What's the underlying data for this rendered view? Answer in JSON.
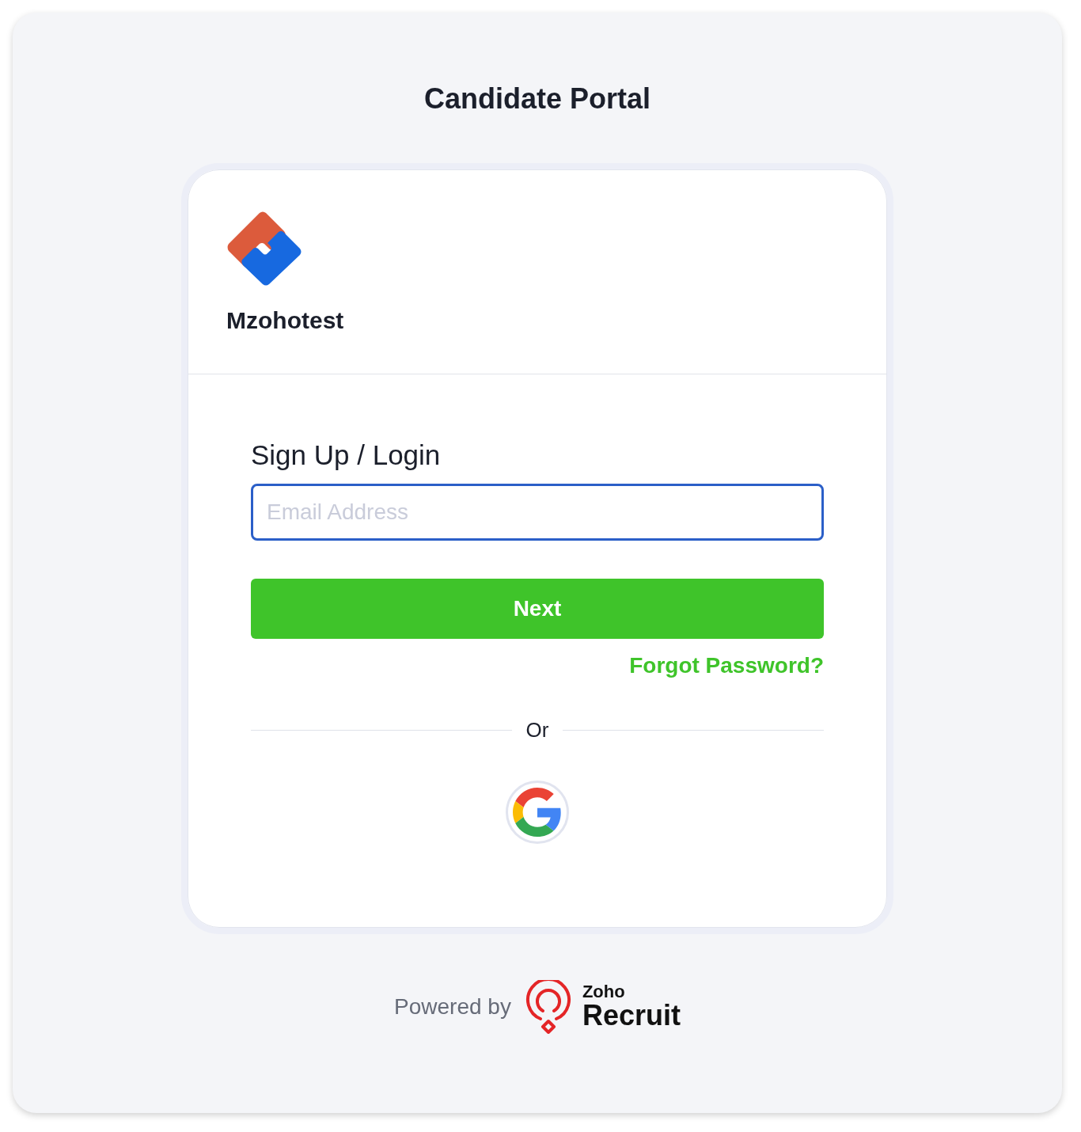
{
  "page": {
    "title": "Candidate Portal"
  },
  "card": {
    "brand": {
      "name": "Mzohotest"
    },
    "form": {
      "heading": "Sign Up / Login",
      "email": {
        "placeholder": "Email Address",
        "focused": true
      },
      "next_button": "Next",
      "forgot_link": "Forgot Password?",
      "divider": "Or"
    }
  },
  "footer": {
    "powered_by": "Powered by",
    "brand_small": "Zoho",
    "brand_large": "Recruit"
  }
}
